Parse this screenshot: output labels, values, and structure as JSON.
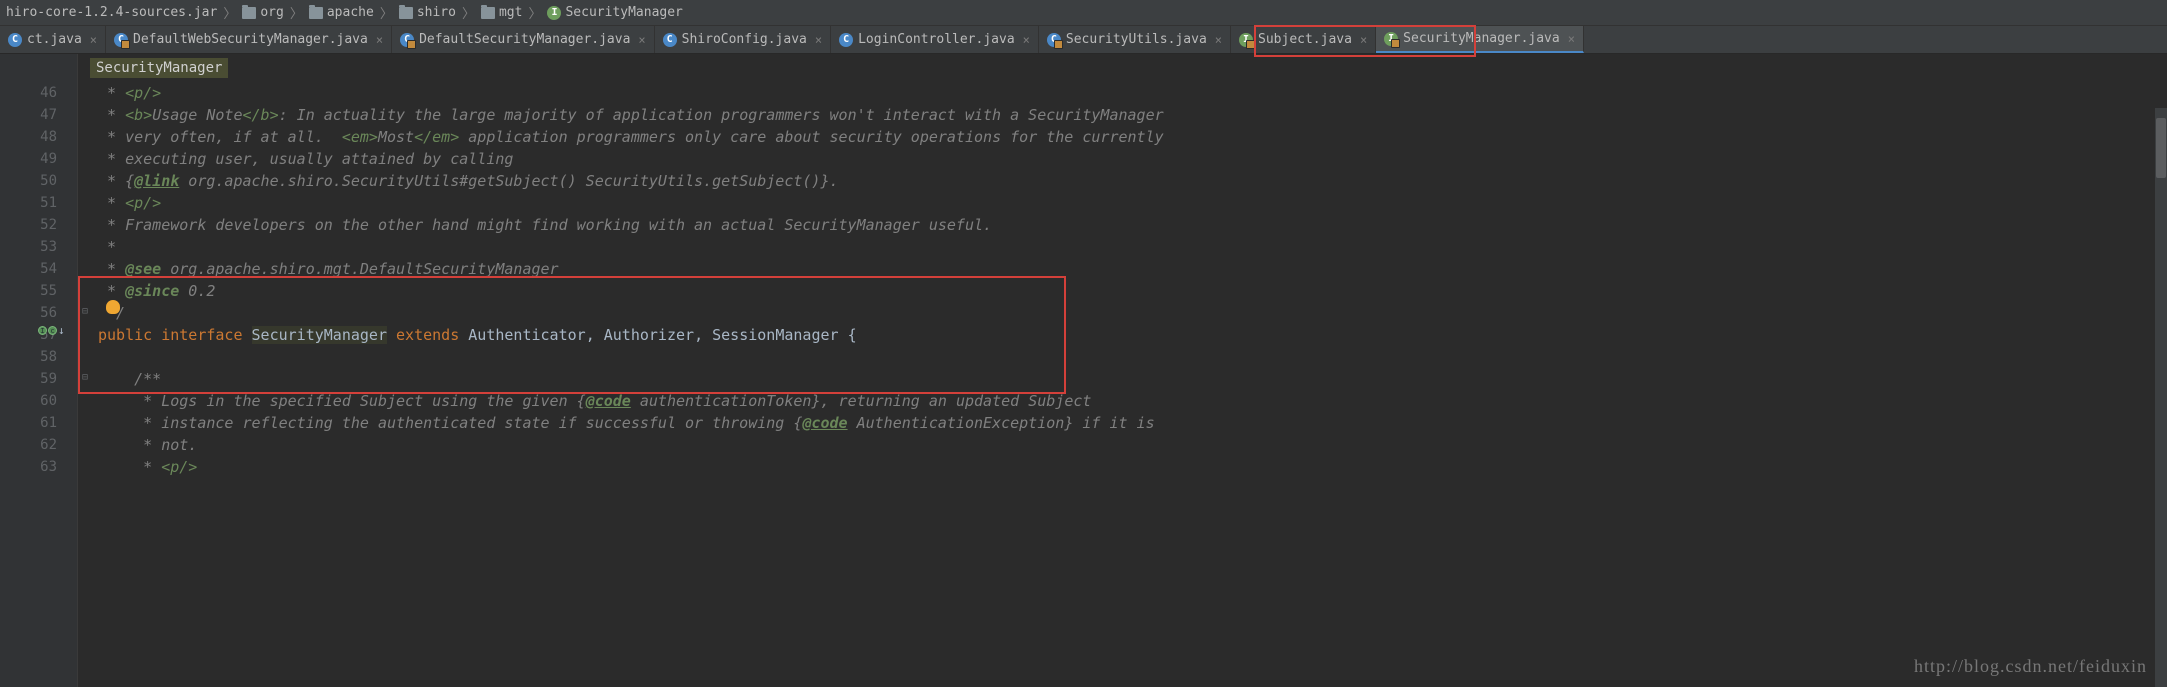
{
  "breadcrumbs": {
    "jar": "hiro-core-1.2.4-sources.jar",
    "pkg1": "org",
    "pkg2": "apache",
    "pkg3": "shiro",
    "pkg4": "mgt",
    "cls": "SecurityManager"
  },
  "tabs": [
    {
      "label": "ct.java",
      "icon": "class",
      "locked": false,
      "active": false
    },
    {
      "label": "DefaultWebSecurityManager.java",
      "icon": "class",
      "locked": true,
      "active": false
    },
    {
      "label": "DefaultSecurityManager.java",
      "icon": "class",
      "locked": true,
      "active": false
    },
    {
      "label": "ShiroConfig.java",
      "icon": "class",
      "locked": false,
      "active": false
    },
    {
      "label": "LoginController.java",
      "icon": "class",
      "locked": false,
      "active": false
    },
    {
      "label": "SecurityUtils.java",
      "icon": "class",
      "locked": true,
      "active": false
    },
    {
      "label": "Subject.java",
      "icon": "interface",
      "locked": true,
      "active": false
    },
    {
      "label": "SecurityManager.java",
      "icon": "interface",
      "locked": true,
      "active": true
    }
  ],
  "editor_breadcrumb": "SecurityManager",
  "line_start": 46,
  "line_end": 63,
  "code_lines": [
    {
      "n": 46,
      "indent": " ",
      "segs": [
        {
          "t": "* ",
          "c": "c-comment"
        },
        {
          "t": "<p/>",
          "c": "c-green"
        }
      ]
    },
    {
      "n": 47,
      "indent": " ",
      "segs": [
        {
          "t": "* ",
          "c": "c-comment"
        },
        {
          "t": "<b>",
          "c": "c-green"
        },
        {
          "t": "Usage Note",
          "c": "c-comment"
        },
        {
          "t": "</b>",
          "c": "c-green"
        },
        {
          "t": ": In actuality the large majority of application programmers won't interact with a SecurityManager",
          "c": "c-comment"
        }
      ]
    },
    {
      "n": 48,
      "indent": " ",
      "segs": [
        {
          "t": "* very often, if at all.  ",
          "c": "c-comment"
        },
        {
          "t": "<em>",
          "c": "c-green"
        },
        {
          "t": "Most",
          "c": "c-comment"
        },
        {
          "t": "</em>",
          "c": "c-green"
        },
        {
          "t": " application programmers only care about security operations for the currently",
          "c": "c-comment"
        }
      ]
    },
    {
      "n": 49,
      "indent": " ",
      "segs": [
        {
          "t": "* executing user, usually attained by calling",
          "c": "c-comment"
        }
      ]
    },
    {
      "n": 50,
      "indent": " ",
      "segs": [
        {
          "t": "* {",
          "c": "c-comment"
        },
        {
          "t": "@link",
          "c": "c-doctag-u"
        },
        {
          "t": " org.apache.shiro.SecurityUtils#getSubject() SecurityUtils.getSubject()",
          "c": "c-comment"
        },
        {
          "t": "}.",
          "c": "c-comment"
        }
      ]
    },
    {
      "n": 51,
      "indent": " ",
      "segs": [
        {
          "t": "* ",
          "c": "c-comment"
        },
        {
          "t": "<p/>",
          "c": "c-green"
        }
      ]
    },
    {
      "n": 52,
      "indent": " ",
      "segs": [
        {
          "t": "* Framework developers on the other hand might find working with an actual SecurityManager useful.",
          "c": "c-comment"
        }
      ]
    },
    {
      "n": 53,
      "indent": " ",
      "segs": [
        {
          "t": "*",
          "c": "c-comment"
        }
      ]
    },
    {
      "n": 54,
      "indent": " ",
      "segs": [
        {
          "t": "* ",
          "c": "c-comment"
        },
        {
          "t": "@see",
          "c": "c-doctag"
        },
        {
          "t": " org.apache.shiro.mgt.DefaultSecurityManager",
          "c": "c-comment"
        }
      ]
    },
    {
      "n": 55,
      "indent": " ",
      "segs": [
        {
          "t": "* ",
          "c": "c-comment"
        },
        {
          "t": "@since",
          "c": "c-doctag"
        },
        {
          "t": " 0.2",
          "c": "c-comment"
        }
      ]
    },
    {
      "n": 56,
      "indent": " ",
      "segs": [
        {
          "t": "*/",
          "c": "c-comment"
        }
      ]
    },
    {
      "n": 57,
      "indent": "",
      "segs": [
        {
          "t": "public ",
          "c": "c-keyword"
        },
        {
          "t": "interface ",
          "c": "c-keyword"
        },
        {
          "t": "SecurityManager",
          "c": "c-type",
          "hl": true
        },
        {
          "t": " ",
          "c": "c-type"
        },
        {
          "t": "extends ",
          "c": "c-keyword"
        },
        {
          "t": "Authenticator",
          "c": "c-type"
        },
        {
          "t": ", ",
          "c": "c-type"
        },
        {
          "t": "Authorizer",
          "c": "c-type"
        },
        {
          "t": ", ",
          "c": "c-type"
        },
        {
          "t": "SessionManager",
          "c": "c-type"
        },
        {
          "t": " {",
          "c": "c-type"
        }
      ]
    },
    {
      "n": 58,
      "indent": "",
      "segs": []
    },
    {
      "n": 59,
      "indent": "    ",
      "segs": [
        {
          "t": "/**",
          "c": "c-comment"
        }
      ]
    },
    {
      "n": 60,
      "indent": "    ",
      "segs": [
        {
          "t": " * Logs in the specified Subject using the given {",
          "c": "c-comment"
        },
        {
          "t": "@code",
          "c": "c-doctag-u"
        },
        {
          "t": " authenticationToken",
          "c": "c-comment"
        },
        {
          "t": "}, returning an updated Subject",
          "c": "c-comment"
        }
      ]
    },
    {
      "n": 61,
      "indent": "    ",
      "segs": [
        {
          "t": " * instance reflecting the authenticated state if successful or throwing {",
          "c": "c-comment"
        },
        {
          "t": "@code",
          "c": "c-doctag-u"
        },
        {
          "t": " AuthenticationException",
          "c": "c-comment"
        },
        {
          "t": "} if it is",
          "c": "c-comment"
        }
      ]
    },
    {
      "n": 62,
      "indent": "    ",
      "segs": [
        {
          "t": " * not.",
          "c": "c-comment"
        }
      ]
    },
    {
      "n": 63,
      "indent": "    ",
      "segs": [
        {
          "t": " * ",
          "c": "c-comment"
        },
        {
          "t": "<p/>",
          "c": "c-green"
        }
      ]
    }
  ],
  "watermark": "http://blog.csdn.net/feiduxin"
}
